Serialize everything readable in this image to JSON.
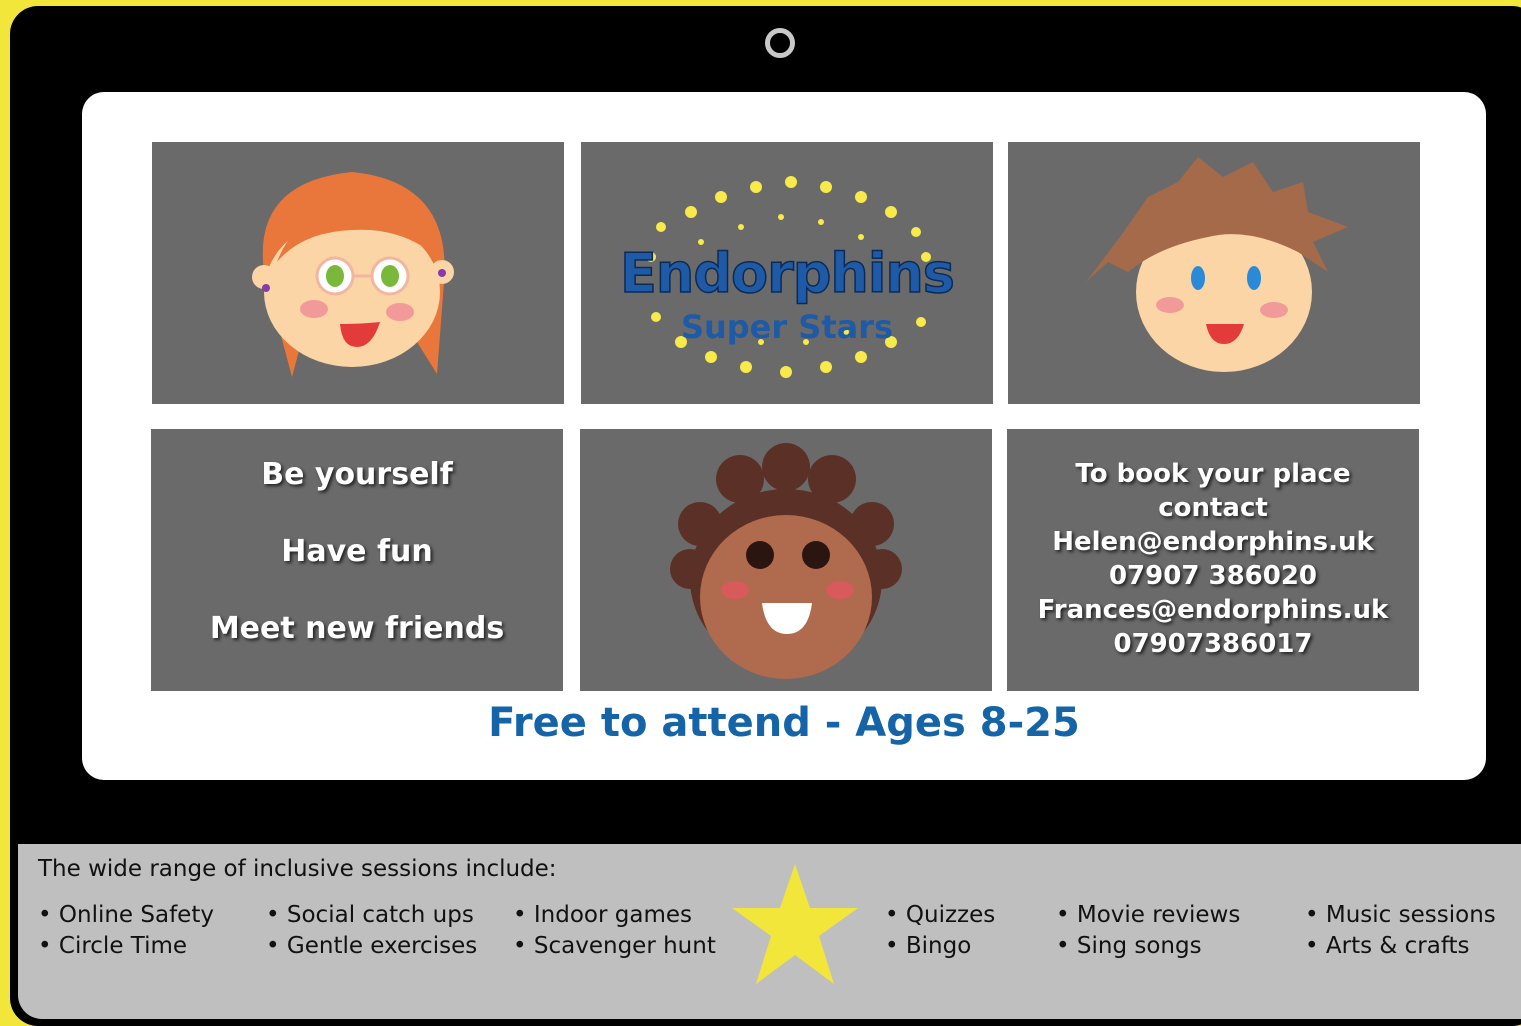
{
  "logo": {
    "title": "Endorphins",
    "subtitle": "Super Stars"
  },
  "motto": {
    "line1": "Be yourself",
    "line2": "Have fun",
    "line3": "Meet new friends"
  },
  "contact": {
    "line1": "To book your place",
    "line2": "contact",
    "email1": "Helen@endorphins.uk",
    "phone1": "07907 386020",
    "email2": "Frances@endorphins.uk",
    "phone2": "07907386017"
  },
  "tagline": "Free to attend - Ages 8-25",
  "sessions": {
    "intro": "The wide range of inclusive sessions include:",
    "col1": [
      "Online Safety",
      "Circle Time"
    ],
    "col2": [
      "Social catch ups",
      "Gentle exercises"
    ],
    "col3": [
      "Indoor games",
      "Scavenger hunt"
    ],
    "col4": [
      "Quizzes",
      "Bingo"
    ],
    "col5": [
      "Movie reviews",
      "Sing songs"
    ],
    "col6": [
      "Music sessions",
      "Arts & crafts"
    ]
  },
  "colors": {
    "frame": "#f2e63a",
    "tablet": "#000000",
    "tile": "#6b6a6a",
    "accent": "#1564a8",
    "star": "#f2e63a"
  },
  "icons": [
    "camera-icon",
    "girl-face-icon",
    "boy-face-icon",
    "child-face-icon",
    "star-icon"
  ]
}
